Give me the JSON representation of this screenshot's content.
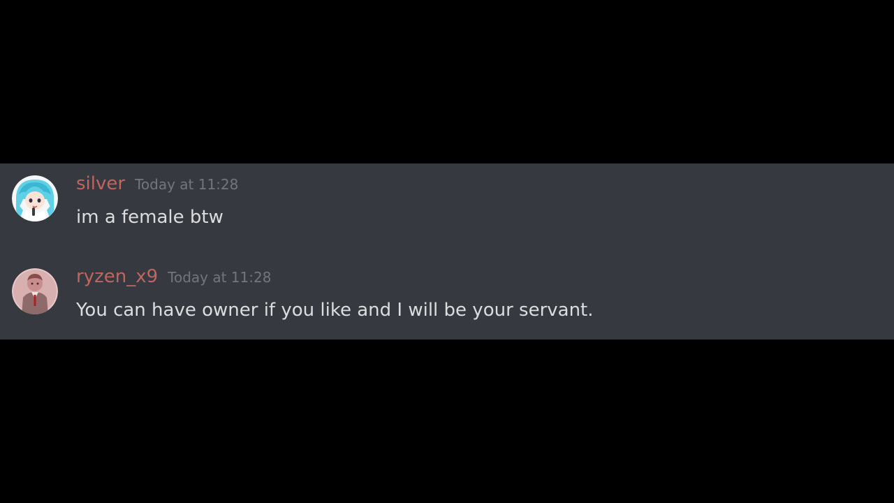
{
  "colors": {
    "background": "#000000",
    "chat_background": "#36393f",
    "username": "#c0655f",
    "timestamp": "#72767d",
    "message_text": "#dcddde"
  },
  "messages": [
    {
      "author": "silver",
      "timestamp": "Today at 11:28",
      "text": "im a female btw",
      "avatar_icon": "anime-girl-avatar"
    },
    {
      "author": "ryzen_x9",
      "timestamp": "Today at 11:28",
      "text": "You can have owner if you like and I will be your servant.",
      "avatar_icon": "suited-figure-avatar"
    }
  ]
}
